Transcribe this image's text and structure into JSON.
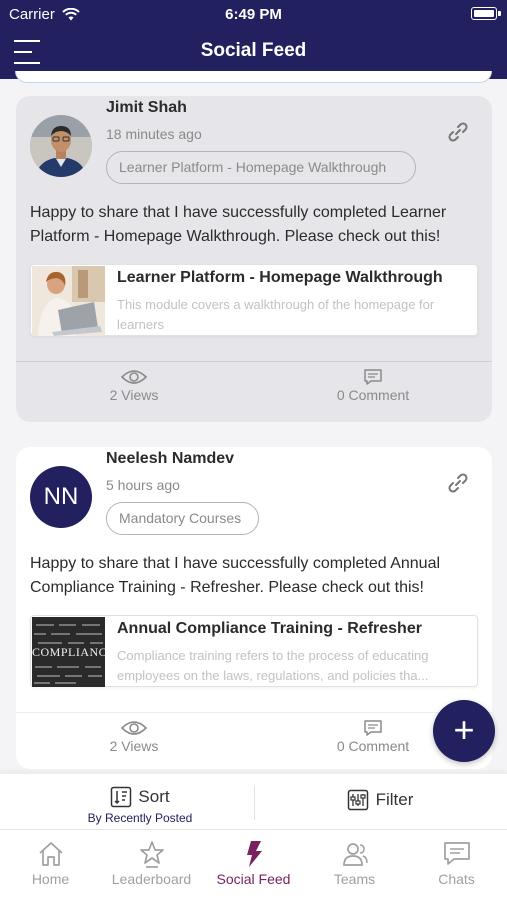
{
  "status_bar": {
    "carrier": "Carrier",
    "time": "6:49 PM"
  },
  "header": {
    "title": "Social Feed"
  },
  "posts": [
    {
      "author": "Jimit Shah",
      "time": "18 minutes ago",
      "tag": "Learner Platform - Homepage Walkthrough",
      "text": "Happy to share that I have successfully completed Learner Platform - Homepage Walkthrough. Please check out this!",
      "module_title": "Learner Platform - Homepage Walkthrough",
      "module_desc": "This module covers a walkthrough of the homepage for learners",
      "views": "2 Views",
      "comments": "0 Comment"
    },
    {
      "author": "Neelesh Namdev",
      "initials": "NN",
      "time": "5 hours ago",
      "tag": "Mandatory Courses",
      "text": "Happy to share that I have successfully completed Annual Compliance Training - Refresher. Please check out this!",
      "module_title": "Annual Compliance Training - Refresher",
      "module_desc": "Compliance training refers to the process of educating employees on the laws, regulations, and policies tha...",
      "thumb_word": "COMPLIANCE",
      "views": "2 Views",
      "comments": "0 Comment"
    }
  ],
  "fab": {
    "label": "+"
  },
  "sort_bar": {
    "sort_label": "Sort",
    "sort_sub": "By Recently Posted",
    "filter_label": "Filter"
  },
  "tabs": [
    {
      "label": "Home",
      "icon": "home-icon"
    },
    {
      "label": "Leaderboard",
      "icon": "star-icon"
    },
    {
      "label": "Social Feed",
      "icon": "lightning-icon",
      "active": true
    },
    {
      "label": "Teams",
      "icon": "users-icon"
    },
    {
      "label": "Chats",
      "icon": "chat-icon"
    }
  ],
  "colors": {
    "brand": "#22205e",
    "active_tab": "#7a1f5f",
    "card_highlight": "#e6e6ea"
  }
}
